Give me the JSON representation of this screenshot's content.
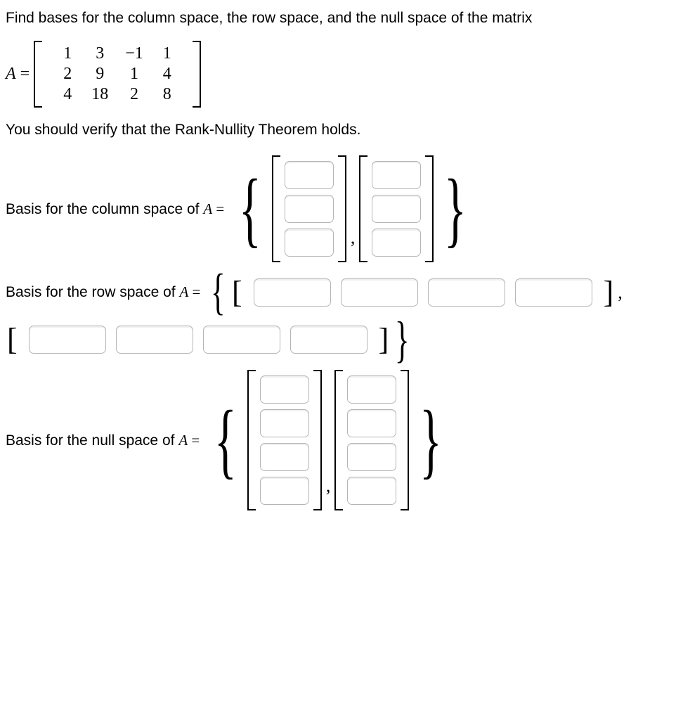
{
  "intro": "Find bases for the column space, the row space, and the null space of the matrix",
  "matrix": {
    "name": "A",
    "rows": [
      [
        "1",
        "3",
        "−1",
        "1"
      ],
      [
        "2",
        "9",
        "1",
        "4"
      ],
      [
        "4",
        "18",
        "2",
        "8"
      ]
    ]
  },
  "verify_text": "You should verify that the Rank-Nullity Theorem holds.",
  "labels": {
    "colspace": "Basis for the column space of ",
    "rowspace": "Basis for the row space of ",
    "nullspace": "Basis for the null space of ",
    "A": "A",
    "equals": " ="
  },
  "chart_data": {
    "type": "table",
    "title": "Matrix A (3×4)",
    "matrix_A": [
      [
        1,
        3,
        -1,
        1
      ],
      [
        2,
        9,
        1,
        4
      ],
      [
        4,
        18,
        2,
        8
      ]
    ],
    "column_space_basis_vector_length": 3,
    "column_space_basis_count": 2,
    "row_space_basis_vector_length": 4,
    "row_space_basis_count": 2,
    "null_space_basis_vector_length": 4,
    "null_space_basis_count": 2
  }
}
